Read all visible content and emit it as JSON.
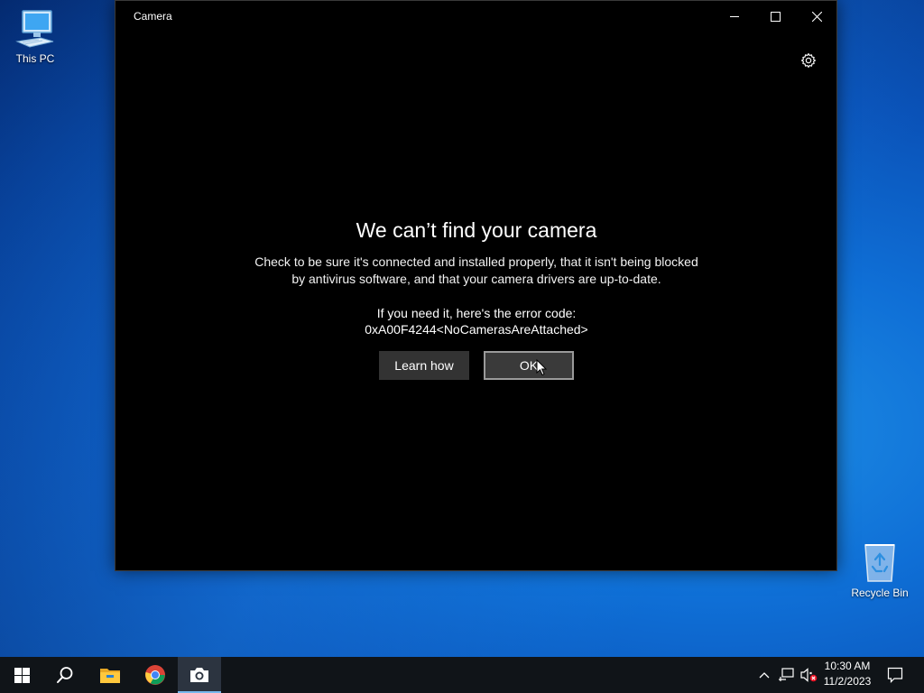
{
  "desktop": {
    "icons": [
      {
        "label": "This PC"
      },
      {
        "label": "Recycle Bin"
      }
    ]
  },
  "window": {
    "title": "Camera",
    "heading": "We can’t find your camera",
    "description_lines": [
      "Check to be sure it's connected and installed properly, that it isn't being blocked",
      "by antivirus software, and that your camera drivers are up-to-date."
    ],
    "error_label": "If you need it, here's the error code:",
    "error_code": "0xA00F4244<NoCamerasAreAttached>",
    "buttons": {
      "learn_label": "Learn how",
      "ok_label": "OK"
    }
  },
  "taskbar": {
    "pinned": [
      "start-icon",
      "search-icon",
      "file-explorer-icon",
      "chrome-icon",
      "camera-icon"
    ],
    "active": "camera-icon",
    "clock": {
      "time": "10:30 AM",
      "date": "11/2/2023"
    }
  },
  "colors": {
    "taskbar_bg": "#101418",
    "window_bg": "#000000",
    "accent": "#76b9ed",
    "ok_border": "#9a9a9a"
  }
}
